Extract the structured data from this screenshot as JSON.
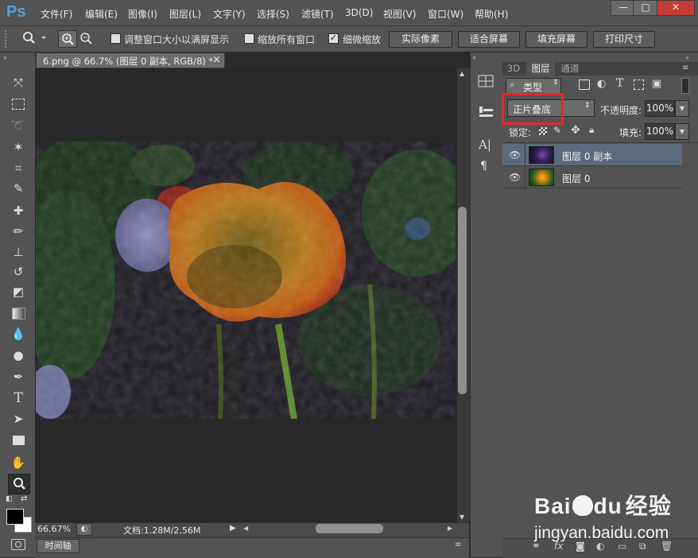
{
  "app": {
    "logo": "Ps"
  },
  "menu": [
    "文件(F)",
    "编辑(E)",
    "图像(I)",
    "图层(L)",
    "文字(Y)",
    "选择(S)",
    "滤镜(T)",
    "3D(D)",
    "视图(V)",
    "窗口(W)",
    "帮助(H)"
  ],
  "window_buttons": {
    "minimize": "—",
    "maximize": "□",
    "close": "✕"
  },
  "options": {
    "resize_window_label": "调整窗口大小以满屏显示",
    "zoom_all_label": "缩放所有窗口",
    "scrubby_zoom_label": "细微缩放",
    "scrubby_zoom_checked": true,
    "actual_pixels": "实际像素",
    "fit_screen": "适合屏幕",
    "fill_screen": "填充屏幕",
    "print_size": "打印尺寸"
  },
  "document": {
    "tab_title": "6.png @ 66.7% (图层 0 副本, RGB/8) *",
    "tab_close": "×"
  },
  "status": {
    "zoom": "66.67%",
    "doc_info": "文档:1.28M/2.56M"
  },
  "timeline": {
    "label": "时间轴"
  },
  "panels": {
    "tabs": [
      "3D",
      "图层",
      "通道"
    ],
    "active_tab": "图层",
    "filter_kind": "类型",
    "blend_mode": "正片叠底",
    "opacity_label": "不透明度:",
    "opacity_value": "100%",
    "lock_label": "锁定:",
    "fill_label": "填充:",
    "fill_value": "100%",
    "layers": [
      {
        "name": "图层 0 副本",
        "selected": true
      },
      {
        "name": "图层 0",
        "selected": false
      }
    ],
    "bottom_icons": [
      "link-icon",
      "fx-icon",
      "mask-icon",
      "adjustment-icon",
      "group-icon",
      "new-layer-icon",
      "trash-icon"
    ]
  },
  "watermark": {
    "brand_a": "Bai",
    "brand_b": "du",
    "brand_c": "经验",
    "url": "jingyan.baidu.com"
  },
  "colors": {
    "highlight_box": "#e8262a",
    "ui_gray": "#535353",
    "selected_layer": "#5c6a7d"
  }
}
